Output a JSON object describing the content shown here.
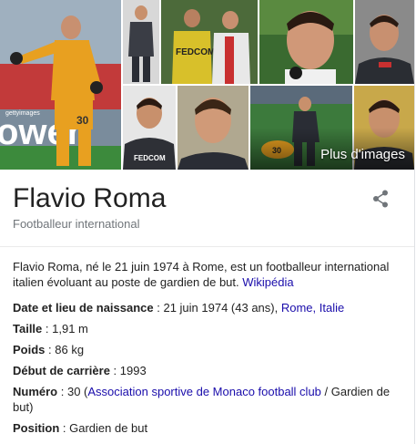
{
  "knowledge_panel": {
    "title": "Flavio Roma",
    "subtitle": "Footballeur international",
    "more_images_label": "Plus d'images",
    "share_icon": "share-icon",
    "description": {
      "text": "Flavio Roma, né le 21 juin 1974 à Rome, est un footballeur international italien évoluant au poste de gardien de but.",
      "link": "Wikipédia"
    },
    "facts": [
      {
        "label": "Date et lieu de naissance",
        "sep": " : ",
        "value_before": "21 juin 1974 (43 ans), ",
        "link": "Rome, Italie",
        "value_after": ""
      },
      {
        "label": "Taille",
        "sep": " : ",
        "value_before": "1,91 m",
        "link": "",
        "value_after": ""
      },
      {
        "label": "Poids",
        "sep": " : ",
        "value_before": "86 kg",
        "link": "",
        "value_after": ""
      },
      {
        "label": "Début de carrière",
        "sep": " : ",
        "value_before": "1993",
        "link": "",
        "value_after": ""
      },
      {
        "label": "Numéro",
        "sep": " : ",
        "value_before": "30 (",
        "link": "Association sportive de Monaco football club",
        "value_after": " / Gardien de but)"
      },
      {
        "label": "Position",
        "sep": " : ",
        "value_before": "Gardien de but",
        "link": "",
        "value_after": ""
      }
    ]
  },
  "image_tiles": [
    {
      "name": "photo-goalkeeper-action",
      "jersey_number": "30",
      "watermark": "gettyimages"
    },
    {
      "name": "photo-player-standing"
    },
    {
      "name": "photo-two-players-fedcom",
      "sponsor_text": "FEDCOM"
    },
    {
      "name": "photo-interview-closeup"
    },
    {
      "name": "photo-portrait-dark"
    },
    {
      "name": "photo-headshot-monaco",
      "sponsor_text": "FEDCOM"
    },
    {
      "name": "photo-headshot-smiling"
    },
    {
      "name": "photo-match-injury",
      "jersey_number": "30"
    },
    {
      "name": "photo-portrait-yellow"
    }
  ],
  "colors": {
    "link": "#1a0dab",
    "subtitle": "#70757a",
    "title": "#222222",
    "divider": "#ebebeb"
  }
}
